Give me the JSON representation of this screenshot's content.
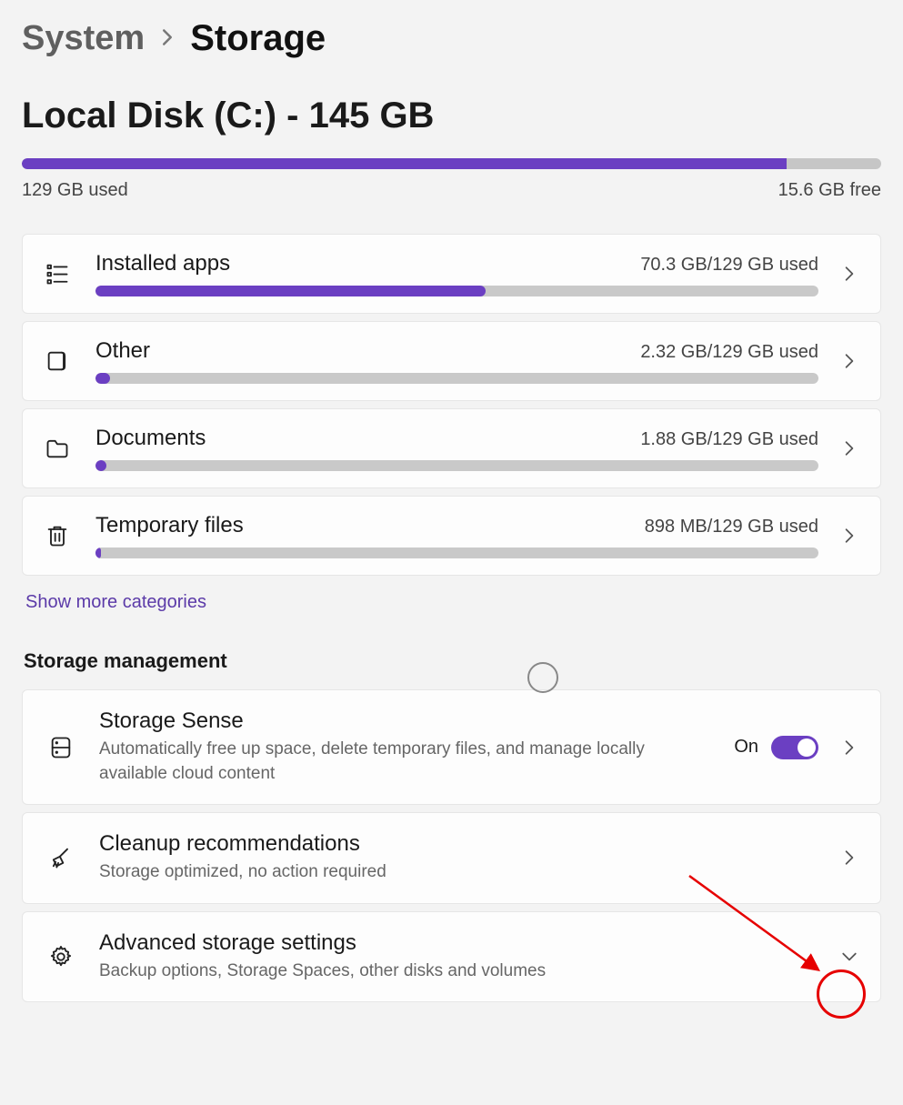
{
  "breadcrumb": {
    "parent": "System",
    "current": "Storage"
  },
  "disk": {
    "title": "Local Disk (C:) - 145 GB",
    "used_label": "129 GB used",
    "free_label": "15.6 GB free",
    "used_pct": 89
  },
  "categories": [
    {
      "name": "Installed apps",
      "usage": "70.3 GB/129 GB used",
      "pct": 54
    },
    {
      "name": "Other",
      "usage": "2.32 GB/129 GB used",
      "pct": 2
    },
    {
      "name": "Documents",
      "usage": "1.88 GB/129 GB used",
      "pct": 1.5
    },
    {
      "name": "Temporary files",
      "usage": "898 MB/129 GB used",
      "pct": 0.8
    }
  ],
  "show_more": "Show more categories",
  "section_title": "Storage management",
  "mgmt": {
    "sense": {
      "title": "Storage Sense",
      "desc": "Automatically free up space, delete temporary files, and manage locally available cloud content",
      "toggle_label": "On",
      "on": true
    },
    "cleanup": {
      "title": "Cleanup recommendations",
      "desc": "Storage optimized, no action required"
    },
    "advanced": {
      "title": "Advanced storage settings",
      "desc": "Backup options, Storage Spaces, other disks and volumes"
    }
  },
  "chart_data": {
    "type": "bar",
    "title": "Local Disk (C:) storage usage",
    "total_gb": 145,
    "used_gb": 129,
    "free_gb": 15.6,
    "categories": [
      "Installed apps",
      "Other",
      "Documents",
      "Temporary files"
    ],
    "values_gb": [
      70.3,
      2.32,
      1.88,
      0.88
    ],
    "denominator_label": "129 GB used"
  }
}
